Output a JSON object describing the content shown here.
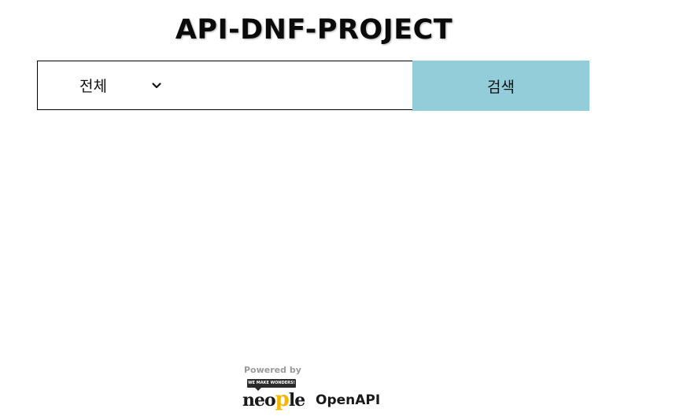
{
  "header": {
    "title": "API-DNF-PROJECT"
  },
  "search": {
    "category_selected": "전체",
    "input_value": "",
    "button_label": "검색",
    "button_color": "#92cdd9"
  },
  "footer": {
    "powered_by": "Powered by",
    "slogan": "WE MAKE WONDERS!",
    "brand_part1": "neo",
    "brand_highlight": "p",
    "brand_part2": "le",
    "service": "OpenAPI",
    "brand_accent_color": "#f2b705"
  }
}
